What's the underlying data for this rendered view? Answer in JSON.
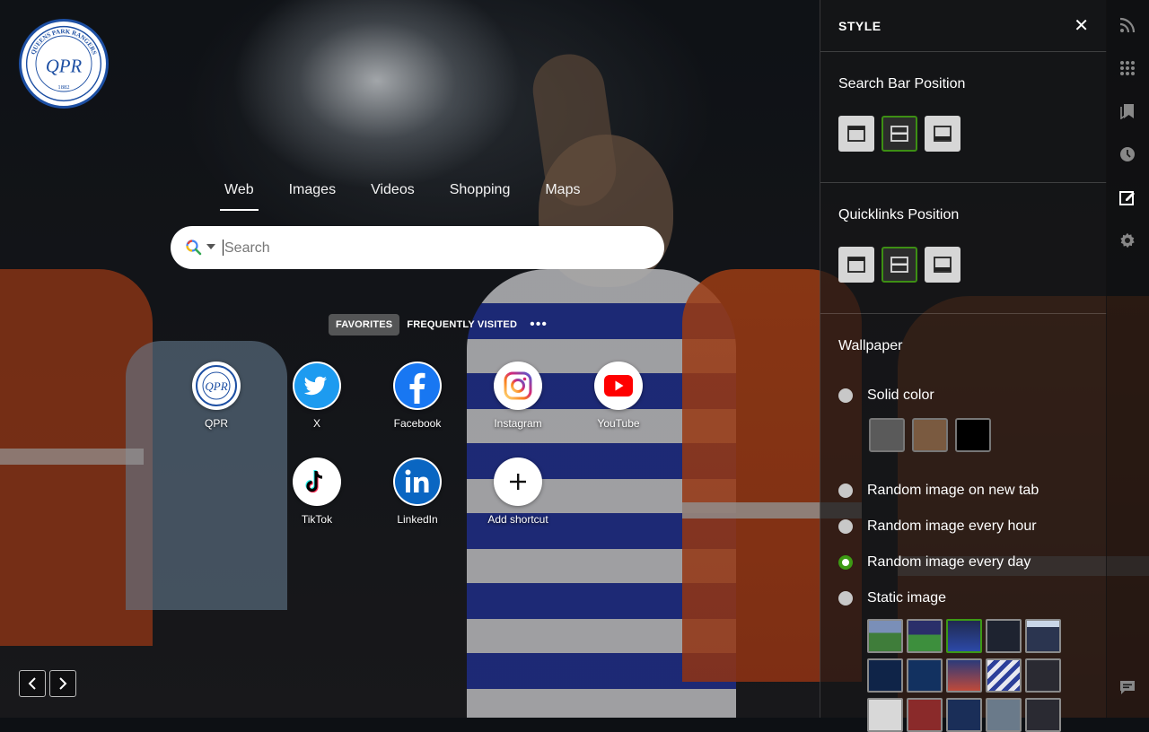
{
  "search": {
    "tabs": [
      "Web",
      "Images",
      "Videos",
      "Shopping",
      "Maps"
    ],
    "active_tab": "Web",
    "placeholder": "Search"
  },
  "quicklinks": {
    "tabs": [
      "FAVORITES",
      "FREQUENTLY VISITED"
    ],
    "active_tab": "FAVORITES",
    "more_label": "•••",
    "items": [
      {
        "label": "QPR",
        "icon": "qpr-logo-icon"
      },
      {
        "label": "X",
        "icon": "twitter-bird-icon"
      },
      {
        "label": "Facebook",
        "icon": "facebook-icon"
      },
      {
        "label": "Instagram",
        "icon": "instagram-icon"
      },
      {
        "label": "YouTube",
        "icon": "youtube-icon"
      },
      {
        "label": "TikTok",
        "icon": "tiktok-icon"
      },
      {
        "label": "LinkedIn",
        "icon": "linkedin-icon"
      },
      {
        "label": "Add shortcut",
        "icon": "plus-icon"
      }
    ]
  },
  "logo": {
    "text_top": "QUEENS PARK RANGERS",
    "year": "1882",
    "monogram": "QPR"
  },
  "panel": {
    "title": "STYLE",
    "close_label": "✕",
    "search_bar_position": {
      "label": "Search Bar Position",
      "selected": "middle"
    },
    "quicklinks_position": {
      "label": "Quicklinks Position",
      "selected": "middle"
    },
    "wallpaper": {
      "label": "Wallpaper",
      "options": [
        "Solid color",
        "Random image on new tab",
        "Random image every hour",
        "Random image every day",
        "Static image"
      ],
      "selected": "Random image every day",
      "solid_colors": [
        "#5a5a5a",
        "#7a5a40",
        "#000000"
      ]
    }
  },
  "colors": {
    "accent": "#3d9a14",
    "logo_blue": "#1d4fa3",
    "panel_bg": "#161618"
  }
}
